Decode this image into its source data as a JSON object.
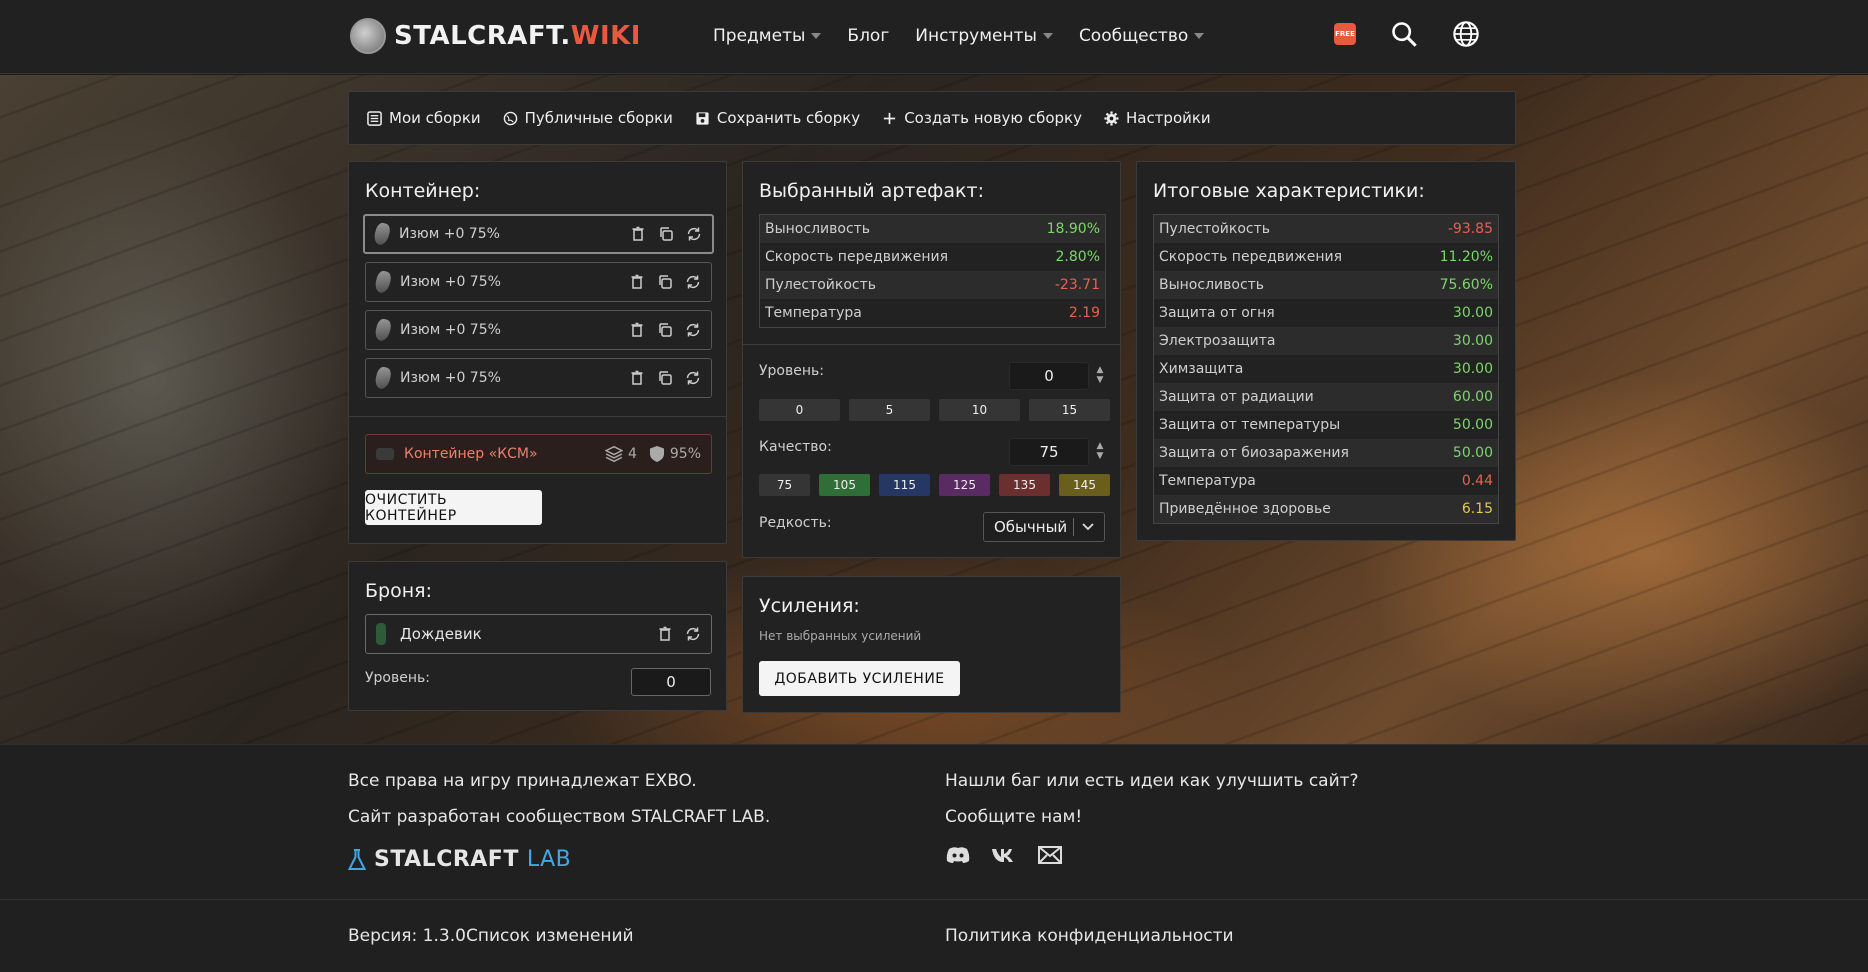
{
  "header": {
    "logo_main": "STALCRAFT.",
    "logo_accent": "WIKI",
    "nav": [
      "Предметы",
      "Блог",
      "Инструменты",
      "Сообщество"
    ],
    "free_badge": "FREE"
  },
  "toolbar": {
    "my_builds": "Мои сборки",
    "public_builds": "Публичные сборки",
    "save_build": "Сохранить сборку",
    "new_build": "Создать новую сборку",
    "settings": "Настройки"
  },
  "container": {
    "title": "Контейнер:",
    "slots": [
      "Изюм +0 75%",
      "Изюм +0 75%",
      "Изюм +0 75%",
      "Изюм +0 75%"
    ],
    "container_name": "Контейнер «КСМ»",
    "capacity": "4",
    "protection": "95%",
    "clear_button": "ОЧИСТИТЬ КОНТЕЙНЕР"
  },
  "armor": {
    "title": "Броня:",
    "name": "Дождевик",
    "level_label": "Уровень:",
    "level_value": "0"
  },
  "artifact": {
    "title": "Выбранный артефакт:",
    "stats": [
      {
        "label": "Выносливость",
        "value": "18.90%",
        "tone": "pos"
      },
      {
        "label": "Скорость передвижения",
        "value": "2.80%",
        "tone": "pos"
      },
      {
        "label": "Пулестойкость",
        "value": "-23.71",
        "tone": "neg"
      },
      {
        "label": "Температура",
        "value": "2.19",
        "tone": "neg"
      }
    ],
    "level_label": "Уровень:",
    "level_value": "0",
    "level_presets": [
      "0",
      "5",
      "10",
      "15"
    ],
    "quality_label": "Качество:",
    "quality_value": "75",
    "quality_presets": [
      {
        "label": "75",
        "color": "#353535"
      },
      {
        "label": "105",
        "color": "#2f6e37"
      },
      {
        "label": "115",
        "color": "#263766"
      },
      {
        "label": "125",
        "color": "#5a2a62"
      },
      {
        "label": "135",
        "color": "#6b2f2f"
      },
      {
        "label": "145",
        "color": "#6a5e1d"
      }
    ],
    "rarity_label": "Редкость:",
    "rarity_value": "Обычный"
  },
  "boosts": {
    "title": "Усиления:",
    "empty_text": "Нет выбранных усилений",
    "add_button": "ДОБАВИТЬ УСИЛЕНИЕ"
  },
  "totals": {
    "title": "Итоговые характеристики:",
    "stats": [
      {
        "label": "Пулестойкость",
        "value": "-93.85",
        "tone": "neg"
      },
      {
        "label": "Скорость передвижения",
        "value": "11.20%",
        "tone": "pos"
      },
      {
        "label": "Выносливость",
        "value": "75.60%",
        "tone": "pos"
      },
      {
        "label": "Защита от огня",
        "value": "30.00",
        "tone": "pos"
      },
      {
        "label": "Электрозащита",
        "value": "30.00",
        "tone": "pos"
      },
      {
        "label": "Химзащита",
        "value": "30.00",
        "tone": "pos"
      },
      {
        "label": "Защита от радиации",
        "value": "60.00",
        "tone": "pos"
      },
      {
        "label": "Защита от температуры",
        "value": "50.00",
        "tone": "pos"
      },
      {
        "label": "Защита от биозаражения",
        "value": "50.00",
        "tone": "pos"
      },
      {
        "label": "Температура",
        "value": "0.44",
        "tone": "neg"
      },
      {
        "label": "Приведённое здоровье",
        "value": "6.15",
        "tone": "yel"
      }
    ]
  },
  "footer": {
    "rights": "Все права на игру принадлежат EXBO.",
    "dev": "Сайт разработан сообществом STALCRAFT LAB.",
    "lab_main": "STALCRAFT",
    "lab_accent": "LAB",
    "bug_q": "Нашли баг или есть идеи как улучшить сайт?",
    "tell_us": "Сообщите нам!",
    "version": "Версия: 1.3.0",
    "changelog": "Список изменений",
    "privacy": "Политика конфиденциальности"
  }
}
